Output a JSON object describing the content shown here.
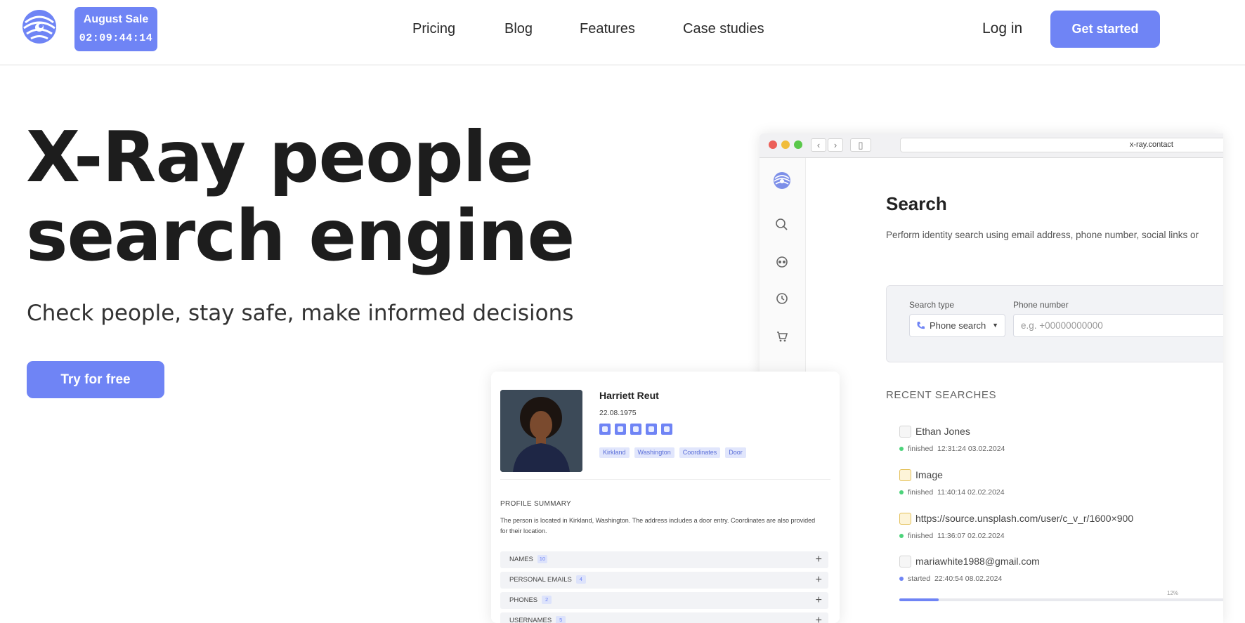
{
  "header": {
    "sale_title": "August Sale",
    "sale_timer": "02:09:44:14",
    "nav": [
      "Pricing",
      "Blog",
      "Features",
      "Case studies"
    ],
    "login": "Log in",
    "cta": "Get started"
  },
  "hero": {
    "title_line1": "X-Ray people",
    "title_line2": "search engine",
    "subtitle": "Check people, stay safe, make informed decisions",
    "try_button": "Try for free"
  },
  "browser": {
    "url": "x-ray.contact",
    "search_title": "Search",
    "search_desc": "Perform identity search using email address, phone number, social links or",
    "search_type_label": "Search type",
    "search_type_value": "Phone search",
    "phone_label": "Phone number",
    "phone_placeholder": "e.g. +00000000000",
    "recent_title": "RECENT SEARCHES",
    "recent": [
      {
        "name": "Ethan Jones",
        "status": "finished",
        "time": "12:31:24 03.02.2024",
        "icon": "person-icon"
      },
      {
        "name": "Image",
        "status": "finished",
        "time": "11:40:14 02.02.2024",
        "icon": "image-icon"
      },
      {
        "name": "https://source.unsplash.com/user/c_v_r/1600×900",
        "status": "finished",
        "time": "11:36:07 02.02.2024",
        "icon": "image-icon"
      },
      {
        "name": "mariawhite1988@gmail.com",
        "status": "started",
        "time": "22:40:54 08.02.2024",
        "icon": "email-icon"
      }
    ],
    "progress_label": "12%",
    "progress_value": 0.12
  },
  "profile": {
    "name": "Harriett Reut",
    "date": "22.08.1975",
    "socials": [
      "facebook-icon",
      "twitter-icon",
      "linkedin-icon",
      "youtube-icon",
      "instagram-icon"
    ],
    "tags": [
      "Kirkland",
      "Washington",
      "Coordinates",
      "Door"
    ],
    "summary_title": "PROFILE SUMMARY",
    "summary_text": "The person is located in Kirkland, Washington. The address includes a door entry. Coordinates are also provided for their location.",
    "sections": [
      {
        "label": "NAMES",
        "count": "10"
      },
      {
        "label": "PERSONAL EMAILS",
        "count": "4"
      },
      {
        "label": "PHONES",
        "count": "2"
      },
      {
        "label": "USERNAMES",
        "count": "5"
      }
    ]
  },
  "colors": {
    "accent": "#6f84f5",
    "status_finished": "#4cd37a",
    "status_started": "#6f84f5"
  }
}
